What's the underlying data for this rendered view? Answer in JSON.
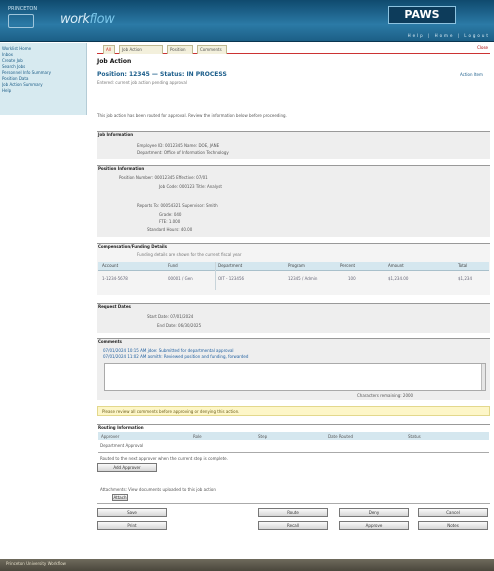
{
  "header": {
    "brand": "PRINCETON",
    "logo_left": "work",
    "logo_right": "flow",
    "product": "PAWS",
    "utility": "Help | Home | Logout"
  },
  "sidebar": {
    "items": [
      "Worklist Home",
      "Inbox",
      "Create Job",
      "Search Jobs",
      "Personnel Info Summary",
      "Position Data",
      "Job Action Summary",
      "Help"
    ]
  },
  "tabs": [
    {
      "label": "All"
    },
    {
      "label": "Job Action"
    },
    {
      "label": "Position"
    },
    {
      "label": "Comments"
    }
  ],
  "tabs_close": "Close",
  "page": {
    "title": "Job Action",
    "subtitle": "Position: 12345 — Status: IN PROCESS",
    "subtitle_note": "Entered: current job action pending approval",
    "right_note": "Action Item",
    "intro": "This job action has been routed for approval. Review the information below before proceeding."
  },
  "section1": {
    "title": "Job Information",
    "line1": "Employee ID: 0012345  Name: DOE, JANE",
    "line2": "Department: Office of Information Technology"
  },
  "section2": {
    "title": "Position Information",
    "line1": "Position Number: 00012345  Effective: 07/01",
    "line2": "Job Code: 000123  Title: Analyst",
    "line3": "Reports To: 00054321  Supervisor: Smith",
    "line4": "Grade: 040",
    "line5": "FTE: 1.000",
    "line6": "Standard Hours: 40.00"
  },
  "section3": {
    "title": "Compensation/Funding Details",
    "subtitle": "Funding details are shown for the current fiscal year",
    "columns": [
      "Account",
      "Fund",
      "Department",
      "Program",
      "Percent",
      "Amount",
      "Total"
    ],
    "rows": [
      [
        "1-1234-5678",
        "00001 / Gen",
        "OIT - 123456",
        "12345 / Admin",
        "100",
        "$1,234.00",
        "$1,234"
      ]
    ]
  },
  "section4": {
    "title": "Request Dates",
    "line1": "Start Date: 07/01/2024",
    "line2": "End Date: 06/30/2025"
  },
  "section5": {
    "title": "Comments",
    "line1": "07/01/2024 10:15 AM jdoe: Submitted for departmental approval",
    "line2": "07/01/2024 11:02 AM asmith: Reviewed position and funding, forwarded",
    "counter": "Characters remaining: 2000"
  },
  "notice": "Please review all comments before approving or denying this action.",
  "section6": {
    "title": "Routing Information",
    "columns": [
      "Approver",
      "Role",
      "Step",
      "Date Routed",
      "Status"
    ],
    "row": "Department Approval",
    "note": "Routed to the next approver when the current step is complete.",
    "btn": "Add Approver"
  },
  "attach": {
    "label": "Attachments: View documents uploaded to this job action",
    "btn": "Attach"
  },
  "buttons": {
    "b1": "Save",
    "b2": "Print",
    "b3": "Route",
    "b4": "Recall",
    "b5": "Deny",
    "b6": "Approve",
    "b7": "Cancel",
    "b8": "Notes"
  },
  "footer": "Princeton University Workflow"
}
